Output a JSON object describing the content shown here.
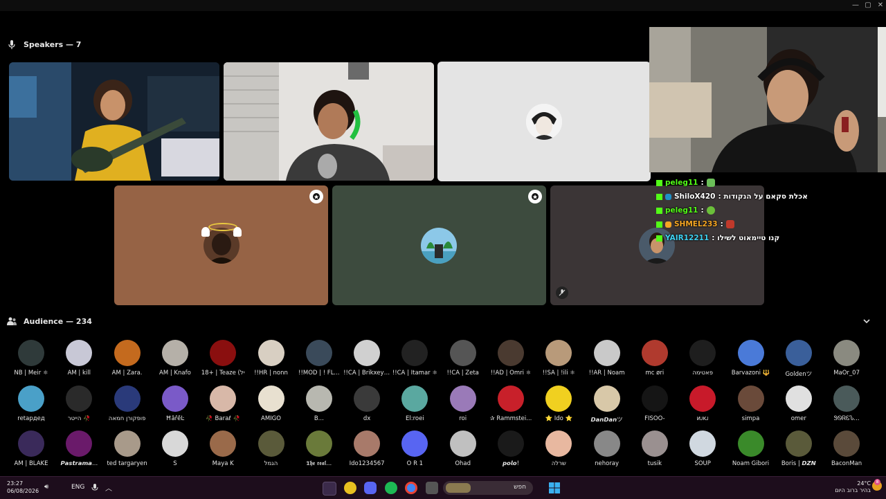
{
  "window": {
    "controls": [
      "—",
      "▢",
      "✕"
    ]
  },
  "speakers": {
    "title": "Speakers — 7"
  },
  "audience": {
    "title": "Audience — 234"
  },
  "chat": [
    {
      "user": "peleg11",
      "color": "#53fc18",
      "text": ":",
      "emote_color": "#6bbf59"
    },
    {
      "user": "ShiloX420",
      "color": "#ffffff",
      "text": ": אכלת סקאם על הנקודות",
      "emote_color": ""
    },
    {
      "user": "peleg11",
      "color": "#53fc18",
      "text": ":",
      "emote_color": "#6bbf3a"
    },
    {
      "user": "SHMEL233",
      "color": "#f5a623",
      "text": ":",
      "emote_color": "#c0392b"
    },
    {
      "user": "YAIR12211",
      "color": "#3fd2f2",
      "text": ": קנו טיימאוט לשילו",
      "emote_color": ""
    }
  ],
  "audience_members": [
    {
      "name": "NB | Meir ⚛",
      "color": "#2f3a3a"
    },
    {
      "name": "AM | kill",
      "color": "#c8c8d6"
    },
    {
      "name": "AM | Zara.",
      "color": "#c46a1e"
    },
    {
      "name": "AM | Knafo",
      "color": "#b5b0a8"
    },
    {
      "name": "18+ | Teaze (יל",
      "color": "#8a0f0f"
    },
    {
      "name": "!!HR | nonn",
      "color": "#d8cfc2"
    },
    {
      "name": "!!MOD | ! FL...",
      "color": "#3a4a5a"
    },
    {
      "name": "!!CA | Brikxey ⚛",
      "color": "#d0d0d0"
    },
    {
      "name": "!!CA | Itamar ⚛",
      "color": "#222222"
    },
    {
      "name": "!!CA | Zeta",
      "color": "#555555"
    },
    {
      "name": "!!AD | Omri ⚛",
      "color": "#4a3a30"
    },
    {
      "name": "!!SA | !ili ⚛",
      "color": "#b89a7a"
    },
    {
      "name": "!!AR | Noam",
      "color": "#c9c9c9"
    },
    {
      "name": "mc øri",
      "color": "#b03a2e"
    },
    {
      "name": "פאטימה",
      "color": "#1e1e1e"
    },
    {
      "name": "Barvazoni 🔱",
      "color": "#4a7ad8"
    },
    {
      "name": "Goldenツ",
      "color": "#3a5f9a"
    },
    {
      "name": "MaOr_07",
      "color": "#8a8a80"
    },
    {
      "name": "retардед",
      "color": "#4aa0c8"
    },
    {
      "name": "הייטר 🥀",
      "color": "#2a2a2a"
    },
    {
      "name": "פופקורן חמאה",
      "color": "#2a3a7a"
    },
    {
      "name": "ĦẫřềĿ",
      "color": "#7a5ac8"
    },
    {
      "name": "🥀 Baraℓ 🥀",
      "color": "#d8b8a8"
    },
    {
      "name": "AMIGO",
      "color": "#e8e0d0"
    },
    {
      "name": "B...",
      "color": "#b8b8b0"
    },
    {
      "name": "dx",
      "color": "#3a3a3a"
    },
    {
      "name": "El:roei",
      "color": "#5aa8a0"
    },
    {
      "name": "roi",
      "color": "#9a7ab8"
    },
    {
      "name": "✰ Rammstei...",
      "color": "#c8202a"
    },
    {
      "name": "⭐ Ido ⭐",
      "color": "#f0d020"
    },
    {
      "name": "𝘿𝙖𝙣𝘿𝙖𝙣ツ",
      "color": "#d8c8a8"
    },
    {
      "name": "FISOO-",
      "color": "#151515"
    },
    {
      "name": "ᴎᴊᴋᴊ",
      "color": "#c81a2a"
    },
    {
      "name": "simpa",
      "color": "#6a4a3a"
    },
    {
      "name": "omer",
      "color": "#e0e0e0"
    },
    {
      "name": "ᏕᏫᏒᏋᏖ...",
      "color": "#4a5a5a"
    },
    {
      "name": "AM | BLAKE",
      "color": "#3a2a5a"
    },
    {
      "name": "𝙋𝙖𝙨𝙩𝙧𝙖𝙢𝙖...",
      "color": "#6a1a6a"
    },
    {
      "name": "ted targaryen",
      "color": "#a89a8a"
    },
    {
      "name": "S",
      "color": "#d8d8d8"
    },
    {
      "name": "Maya K",
      "color": "#9a6a4a"
    },
    {
      "name": "הגמל",
      "color": "#5a5a3a"
    },
    {
      "name": "𝕿𝖍𝖊 𝖗𝖊𝖆𝖑...",
      "color": "#6a7a3a"
    },
    {
      "name": "Ido1234567",
      "color": "#a87a6a"
    },
    {
      "name": "O R 1",
      "color": "#5865f2"
    },
    {
      "name": "Ohad",
      "color": "#c0c0c0"
    },
    {
      "name": "𝙥𝙤𝙡𝙤!",
      "color": "#1a1a1a"
    },
    {
      "name": "שרלה",
      "color": "#e8b8a0"
    },
    {
      "name": "nehoray",
      "color": "#888888"
    },
    {
      "name": "tusik",
      "color": "#9a9090"
    },
    {
      "name": "SOUP",
      "color": "#d0d8e0"
    },
    {
      "name": "Noam Gibori",
      "color": "#3a8a2a"
    },
    {
      "name": "Boris | 𝘿𝙕𝙉",
      "color": "#5a5a3a"
    },
    {
      "name": "BaconMan",
      "color": "#5a4a3a"
    }
  ],
  "taskbar": {
    "time": "23:27",
    "date": "06/08/2026",
    "lang": "ENG",
    "search_placeholder": "חפש",
    "temp": "24°C",
    "weather": "בהיר ברוב היום",
    "notif_count": "8"
  }
}
